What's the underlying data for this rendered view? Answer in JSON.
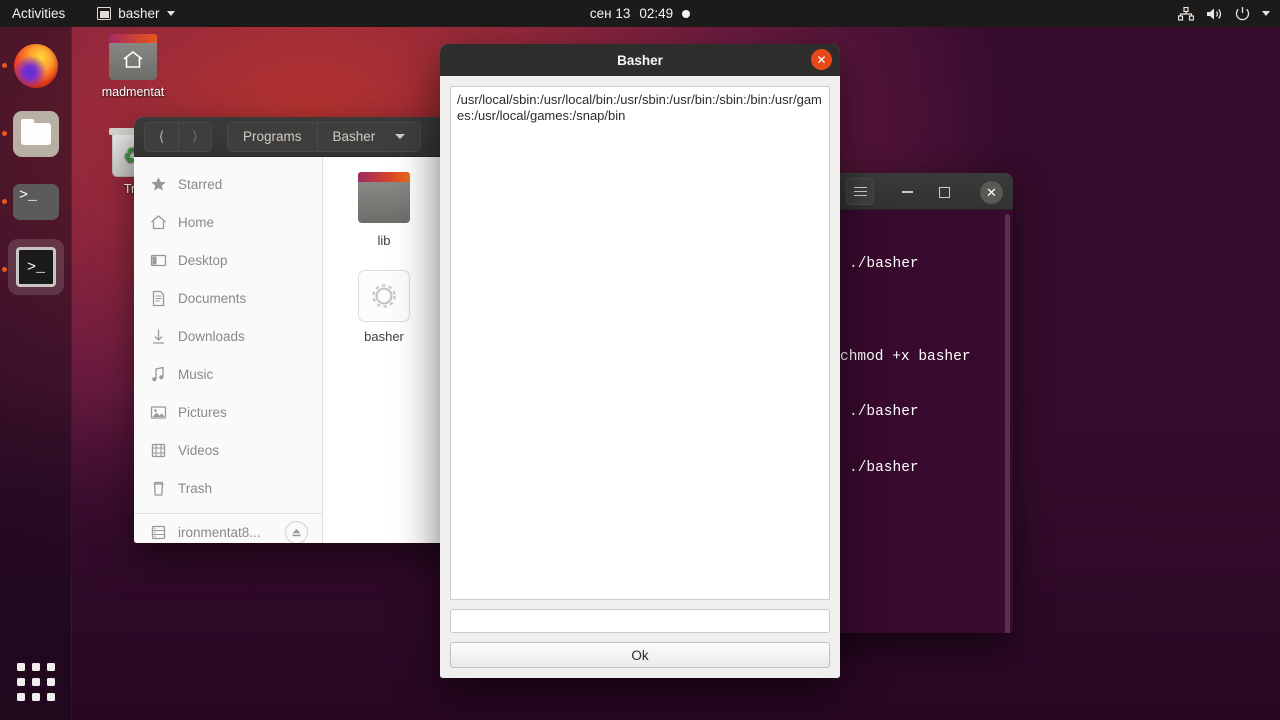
{
  "topbar": {
    "activities": "Activities",
    "app_menu": {
      "label": "basher",
      "window_icon": "window-icon",
      "caret": "chevron-down-icon"
    },
    "clock": {
      "date": "сен 13",
      "time": "02:49",
      "notification_dot": "notification-dot"
    },
    "tray": {
      "network": "network-icon",
      "volume": "volume-icon",
      "power": "power-icon",
      "caret": "chevron-down-icon"
    }
  },
  "dock": {
    "items": [
      {
        "name": "firefox",
        "label": "Firefox",
        "running": true,
        "active": false
      },
      {
        "name": "files",
        "label": "Files",
        "running": true,
        "active": false
      },
      {
        "name": "terminal",
        "label": "Terminal",
        "running": true,
        "active": false
      },
      {
        "name": "basher-terminal",
        "label": "Basher",
        "running": true,
        "active": true
      }
    ],
    "show_apps": "show-applications-icon"
  },
  "desktop_icons": [
    {
      "name": "home-folder",
      "label": "madmentat",
      "icon": "home-folder-icon"
    },
    {
      "name": "trash",
      "label": "Tra",
      "icon": "trash-icon"
    }
  ],
  "terminal": {
    "titlebar": {
      "menu": "hamburger-icon",
      "minimize": "minimize-icon",
      "maximize": "maximize-icon",
      "close": "close-icon"
    },
    "lines": [
      "./basher",
      "",
      "chmod +x basher",
      "./basher",
      "./basher"
    ]
  },
  "nautilus": {
    "nav": {
      "back": "chevron-left-icon",
      "forward": "chevron-right-icon"
    },
    "breadcrumbs": [
      {
        "label": "Programs"
      },
      {
        "label": "Basher",
        "has_menu": true
      }
    ],
    "places": [
      {
        "label": "Starred",
        "icon": "star-icon"
      },
      {
        "label": "Home",
        "icon": "home-icon"
      },
      {
        "label": "Desktop",
        "icon": "desktop-icon"
      },
      {
        "label": "Documents",
        "icon": "document-icon"
      },
      {
        "label": "Downloads",
        "icon": "download-icon"
      },
      {
        "label": "Music",
        "icon": "music-note-icon"
      },
      {
        "label": "Pictures",
        "icon": "picture-icon"
      },
      {
        "label": "Videos",
        "icon": "video-icon"
      },
      {
        "label": "Trash",
        "icon": "trash-icon"
      }
    ],
    "device": {
      "label": "ironmentat8...",
      "icon": "drive-icon",
      "eject": "eject-icon"
    },
    "files": [
      {
        "label": "lib",
        "type": "folder"
      },
      {
        "label": "basher",
        "type": "executable"
      }
    ]
  },
  "dialog": {
    "title": "Basher",
    "close": "close-icon",
    "output_text": "/usr/local/sbin:/usr/local/bin:/usr/sbin:/usr/bin:/sbin:/bin:/usr/games:/usr/local/games:/snap/bin",
    "input_value": "",
    "input_placeholder": "",
    "ok_label": "Ok"
  },
  "colors": {
    "accent_orange": "#e8491b",
    "titlebar_dark": "#2e2d2c",
    "terminal_bg": "#380a2e",
    "running_dot": "#e8581f"
  }
}
